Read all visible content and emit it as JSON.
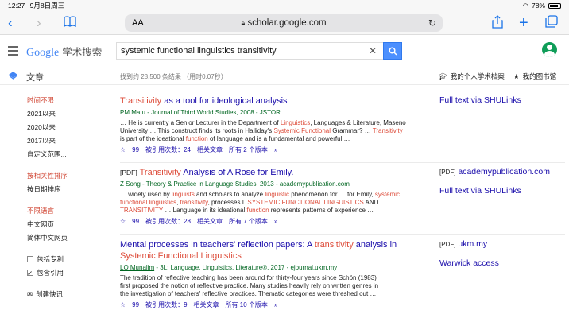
{
  "status": {
    "time": "12:27",
    "date": "9月8日周三",
    "battery": "78%"
  },
  "browser": {
    "aa": "AA",
    "url": "scholar.google.com"
  },
  "header": {
    "logo_google": "Google",
    "logo_suffix": "学术搜索",
    "query": "systemic functional linguistics transitivity"
  },
  "info": {
    "articles_label": "文章",
    "count": "找到约 28,500 条结果 （用时0.07秒）",
    "my_profile": "我的个人学术档案",
    "my_library": "我的图书馆"
  },
  "sidebar": {
    "time": [
      "时间不限",
      "2021以来",
      "2020以来",
      "2017以来",
      "自定义范围..."
    ],
    "sort": [
      "按相关性排序",
      "按日期排序"
    ],
    "lang": [
      "不限语言",
      "中文网页",
      "简体中文网页"
    ],
    "patents": "包括专利",
    "citations": "包含引用",
    "alert": "创建快讯"
  },
  "results": [
    {
      "tag": "",
      "title_hl": "Transitivity",
      "title_rest": " as a tool for ideological analysis",
      "title_hl2": "",
      "meta": "PM Matu - Journal of Third World Studies, 2008 - JSTOR",
      "snippet": [
        [
          "… He is currently a Senior Lecturer in the Department of ",
          "Linguistics",
          ", Languages & Literature, Maseno"
        ],
        [
          "University … This construct finds its roots in Halliday's ",
          "Systemic Functional",
          " Grammar? … ",
          "Transitivity"
        ],
        [
          "is part of the ideational ",
          "function",
          " of language and is a fundamental and powerful …"
        ]
      ],
      "cited": "被引用次数：24",
      "related": "相关文章",
      "versions": "所有 2 个版本"
    },
    {
      "tag": "[PDF]",
      "title_hl": "Transitivity",
      "title_rest": " Analysis of A Rose for Emily.",
      "title_hl2": "",
      "meta": "Z Song - Theory & Practice in Language Studies, 2013 - academypublication.com",
      "snippet": [
        [
          "… widely used by ",
          "linguists",
          " and scholars to analyze ",
          "linguistic",
          " phenomenon for … for Emily, ",
          "systemic"
        ],
        [
          "functional linguistics",
          ", ",
          "transitivity",
          ", processes I. ",
          "SYSTEMIC FUNCTIONAL LINGUISTICS",
          " AND"
        ],
        [
          "TRANSITIVITY",
          " … Language in its ideational ",
          "function",
          " represents patterns of experience …"
        ]
      ],
      "cited": "被引用次数：28",
      "related": "相关文章",
      "versions": "所有 7 个版本"
    },
    {
      "tag": "",
      "title_hl": "Mental processes in teachers' reflection papers: A ",
      "title_rest": "transitivity",
      "title_hl2": " analysis in",
      "title_line2": "Systemic Functional Linguistics",
      "meta_author": "LO Munalim",
      "meta": " - 3L: Language, Linguistics, Literature®, 2017 - ejournal.ukm.my",
      "snippet_plain": [
        "The tradition of reflective teaching has been around for thirty-four years since Schön (1983)",
        "first proposed the notion of reflective practice. Many studies heavily rely on written genres in",
        "the investigation of teachers' reflective practices. Thematic categories were threshed out …"
      ],
      "cited": "被引用次数：9",
      "related": "相关文章",
      "versions": "所有 10 个版本"
    }
  ],
  "side_links": [
    {
      "pdf": "",
      "text": "Full text via SHULinks"
    },
    {
      "pdf": "[PDF]",
      "text": "academypublication.com"
    },
    {
      "pdf": "",
      "text": "Full text via SHULinks"
    },
    {
      "pdf": "[PDF]",
      "text": "ukm.my"
    },
    {
      "pdf": "",
      "text": "Warwick access"
    }
  ],
  "colors": {
    "link": "#1a0dab",
    "highlight": "#dd4b39",
    "meta": "#006621",
    "search_button": "#4d90fe",
    "filter_red": "#d14836"
  }
}
